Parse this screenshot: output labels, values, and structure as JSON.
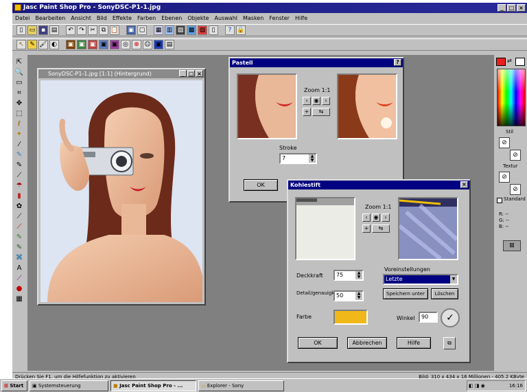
{
  "app": {
    "title": "Jasc Paint Shop Pro - SonyDSC-P1-1.jpg",
    "menu": [
      "Datei",
      "Bearbeiten",
      "Ansicht",
      "Bild",
      "Effekte",
      "Farben",
      "Ebenen",
      "Objekte",
      "Auswahl",
      "Masken",
      "Fenster",
      "Hilfe"
    ]
  },
  "image_window": {
    "title": "SonyDSC-P1-1.jpg [1:1] (Hintergrund)"
  },
  "dialog_1": {
    "title": "Pastell",
    "zoom_label": "Zoom 1:1",
    "field_label": "Stroke",
    "field_value": "7",
    "ok_label": "OK"
  },
  "dialog_2": {
    "title": "Kohlestift",
    "zoom_label": "Zoom 1:1",
    "presets_label": "Voreinstellungen",
    "preset_value": "Letzte",
    "save_label": "Speichern unter",
    "delete_label": "Löschen",
    "field1_label": "Deckkraft",
    "field1_value": "75",
    "field2_label": "Detail/genauigkeit",
    "field2_value": "50",
    "color_label": "Farbe",
    "color_value": "#f0b818",
    "angle_label": "Winkel",
    "angle_value": "90",
    "ok_label": "OK",
    "cancel_label": "Abbrechen",
    "help_label": "Hilfe"
  },
  "right_panel": {
    "label1": "Stil",
    "label2": "Textur",
    "standard_label": "Standard"
  },
  "status": {
    "left": "Drücken Sie F1, um die Hilfefunktion zu aktivieren",
    "right": "Bild: 310 x 434 x 16 Millionen - 405,2 KByte"
  },
  "taskbar": {
    "start": "Start",
    "tasks": [
      "Systemsteuerung",
      "Jasc Paint Shop Pro - ...",
      "Explorer - Sony"
    ],
    "clock": "16:16"
  }
}
